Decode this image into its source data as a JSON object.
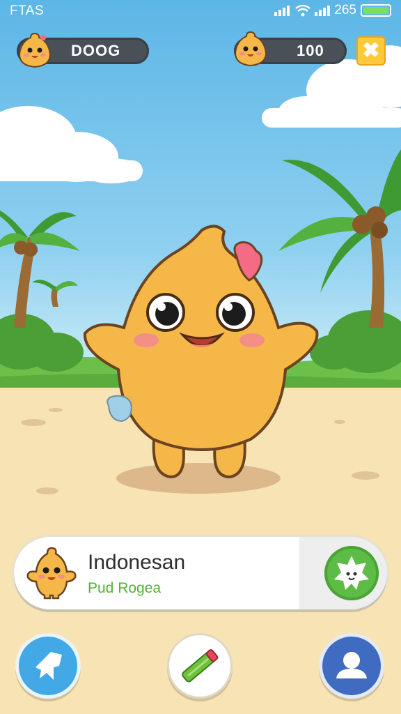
{
  "status_bar": {
    "left_text": "FTAS",
    "right_text": "265",
    "icons": [
      "signal-icon",
      "wifi-icon",
      "cellular-icon",
      "battery-icon"
    ]
  },
  "top_bar": {
    "player_name": "DOOG",
    "currency_value": "100",
    "close_icon": "close-icon"
  },
  "character_card": {
    "title": "Indonesan",
    "subtitle": "Pud Rogea",
    "action_icon": "star-face-icon"
  },
  "bottom_nav": {
    "items": [
      {
        "name": "home-button",
        "icon": "house-icon",
        "color": "#43a9e6"
      },
      {
        "name": "feed-button",
        "icon": "pencil-icon",
        "color": "#ffffff"
      },
      {
        "name": "profile-button",
        "icon": "person-icon",
        "color": "#3f6cc0"
      }
    ]
  },
  "colors": {
    "sky": "#5cb6e6",
    "sand": "#f7e3b3",
    "accent_green": "#5cbc45",
    "pill_bg": "#4a5058",
    "character": "#f5b748"
  }
}
